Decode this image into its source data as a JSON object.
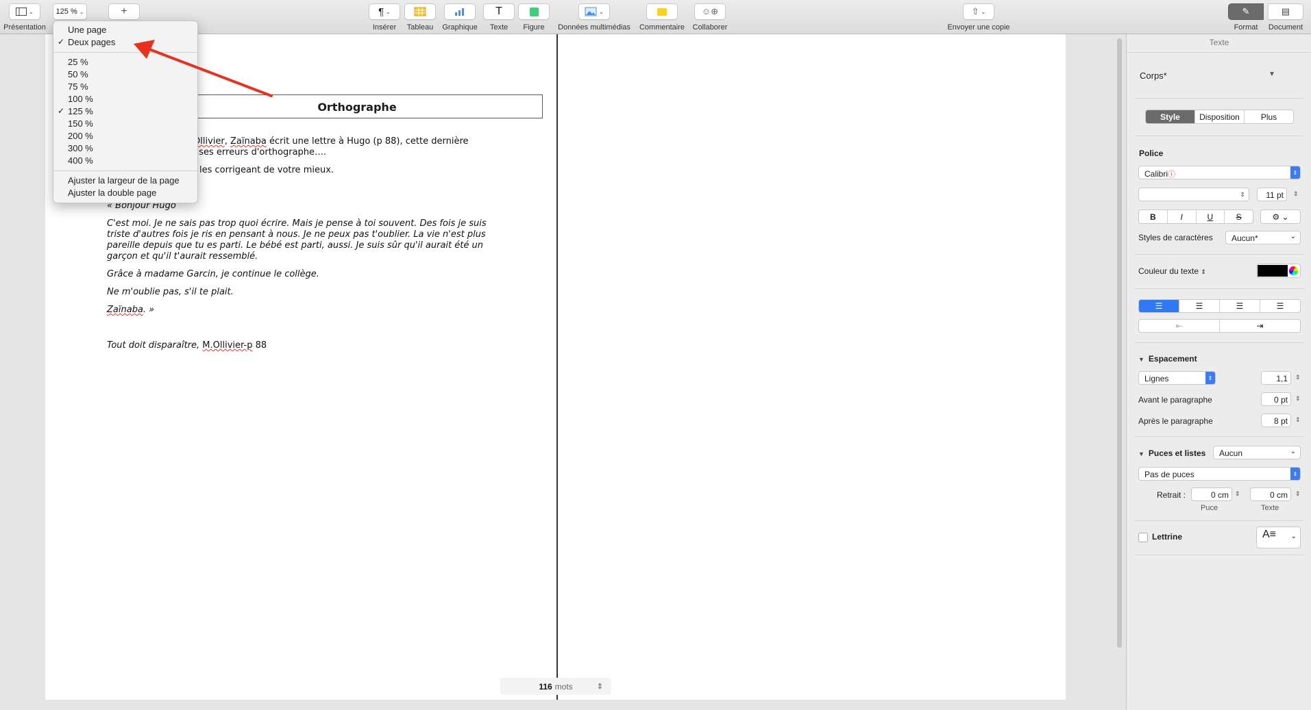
{
  "toolbar": {
    "presentation_label": "Présentation",
    "zoom_value": "125 %",
    "insert_label": "Insérer",
    "table_label": "Tableau",
    "chart_label": "Graphique",
    "text_label": "Texte",
    "shape_label": "Figure",
    "media_label": "Données multimédias",
    "comment_label": "Commentaire",
    "collaborate_label": "Collaborer",
    "send_copy_label": "Envoyer une copie",
    "format_label": "Format",
    "document_label": "Document"
  },
  "zoom_menu": {
    "view_options": [
      "Une page",
      "Deux pages"
    ],
    "checked_view": "Deux pages",
    "levels": [
      "25 %",
      "50 %",
      "75 %",
      "100 %",
      "125 %",
      "150 %",
      "200 %",
      "300 %",
      "400 %"
    ],
    "checked_level": "125 %",
    "fit_options": [
      "Ajuster la largeur de la page",
      "Ajuster la double page"
    ]
  },
  "document": {
    "title": "Orthographe",
    "intro_line1_pre": "Ollivier",
    "intro_line1_mid": ", ",
    "intro_line1_name": "Zaïnaba",
    "intro_line1_post": " écrit une lettre à Hugo (p 88), cette dernière",
    "intro_line2": "uses erreurs d'orthographe….",
    "intro_line3": "les corrigeant de votre mieux.",
    "greeting": "« Bonjour Hugo",
    "para1": [
      "C'est moi. Je ne sais pas trop quoi écrire. Mais je pense à toi souvent. Des fois je suis",
      "triste d'autres fois je ris en pensant à nous. Je ne peux pas t'oublier. La vie n'est plus",
      "pareille depuis que tu es parti. Le bébé est parti, aussi. Je suis sûr qu'il aurait été un",
      "garçon et qu'il t'aurait ressemblé."
    ],
    "para2": "Grâce à madame Garcin, je continue le collège.",
    "para3": "Ne m'oublie pas, s'il te plait.",
    "signature_name": "Zaïnaba",
    "signature_end": ". »",
    "source_pre": "Tout doit disparaître, ",
    "source_author": "M.Ollivier-p",
    "source_post": " 88"
  },
  "word_count": {
    "count": "116",
    "unit": "mots"
  },
  "inspector": {
    "header": "Texte",
    "paragraph_style": "Corps*",
    "tabs": [
      "Style",
      "Disposition",
      "Plus"
    ],
    "active_tab": "Style",
    "font_section": "Police",
    "font_name": "Calibri",
    "font_size": "11 pt",
    "char_styles_label": "Styles de caractères",
    "char_styles_value": "Aucun*",
    "text_color_label": "Couleur du texte",
    "text_color": "#000000",
    "spacing_section": "Espacement",
    "spacing_mode": "Lignes",
    "spacing_value": "1,1",
    "before_label": "Avant le paragraphe",
    "before_value": "0 pt",
    "after_label": "Après le paragraphe",
    "after_value": "8 pt",
    "bullets_section": "Puces et listes",
    "bullets_value": "Aucun",
    "bullets_type": "Pas de puces",
    "indent_label": "Retrait :",
    "bullet_indent": "0 cm",
    "text_indent": "0 cm",
    "bullet_caption": "Puce",
    "text_caption": "Texte",
    "dropcap_label": "Lettrine",
    "accent_color": "#2f7af4"
  },
  "annotation": {
    "arrow_color": "#e8321f"
  }
}
